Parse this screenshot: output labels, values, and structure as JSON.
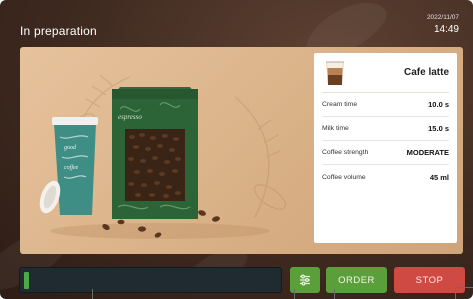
{
  "status": {
    "title": "In preparation"
  },
  "clock": {
    "date": "2022/11/07",
    "time": "14:49"
  },
  "product": {
    "name": "Cafe latte",
    "icon": "latte-glass-icon",
    "rows": [
      {
        "label": "Cream time",
        "value": "10.0 s"
      },
      {
        "label": "Milk time",
        "value": "15.0 s"
      },
      {
        "label": "Coffee strength",
        "value": "MODERATE"
      },
      {
        "label": "Coffee volume",
        "value": "45 ml"
      }
    ]
  },
  "progress": {
    "value_percent": 2,
    "color": "#4caa45"
  },
  "actions": {
    "filter_icon": "sliders-icon",
    "order_label": "ORDER",
    "stop_label": "STOP"
  },
  "colors": {
    "background": "#3f2a20",
    "panel": "#dcb68c",
    "accent_green": "#5a9f3a",
    "stop_red": "#cf4a43",
    "progress_track": "#1f2a31"
  }
}
